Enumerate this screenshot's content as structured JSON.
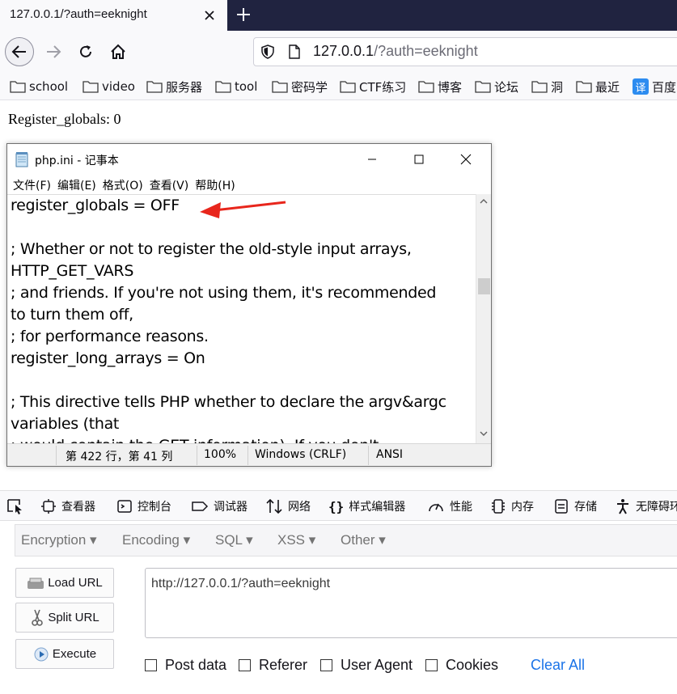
{
  "browser": {
    "tab_title": "127.0.0.1/?auth=eeknight",
    "url_host": "127.0.0.1",
    "url_rest": "/?auth=eeknight",
    "bookmarks": [
      "school",
      "video",
      "服务器",
      "tool",
      "密码学",
      "CTF练习",
      "博客",
      "论坛",
      "洞",
      "最近",
      "百度"
    ]
  },
  "page": {
    "register_text": "Register_globals: 0"
  },
  "notepad": {
    "title": "php.ini - 记事本",
    "menu": [
      "文件(F)",
      "编辑(E)",
      "格式(O)",
      "查看(V)",
      "帮助(H)"
    ],
    "lines": [
      "register_globals = OFF",
      "",
      "; Whether or not to register the old-style input arrays,",
      "HTTP_GET_VARS",
      "; and friends.  If you're not using them, it's recommended",
      "to turn them off,",
      "; for performance reasons.",
      "register_long_arrays = On",
      "",
      "; This directive tells PHP whether to declare the argv&argc",
      "variables (that",
      "; would contain the GET information).  If you don't"
    ],
    "status": {
      "position": "第 422 行，第 41 列",
      "zoom": "100%",
      "eol": "Windows (CRLF)",
      "encoding": "ANSI"
    },
    "arrow_color": "#e8261c"
  },
  "devtools": {
    "tabs": [
      "查看器",
      "控制台",
      "调试器",
      "网络",
      "样式编辑器",
      "性能",
      "内存",
      "存储",
      "无障碍环境"
    ]
  },
  "hackbar": {
    "menus": [
      "Encryption",
      "Encoding",
      "SQL",
      "XSS",
      "Other"
    ],
    "buttons": [
      "Load URL",
      "Split URL",
      "Execute"
    ],
    "url_value": "http://127.0.0.1/?auth=eeknight",
    "checkboxes": [
      "Post data",
      "Referer",
      "User Agent",
      "Cookies"
    ],
    "clear_all": "Clear All",
    "link_color": "#1a73e8"
  }
}
